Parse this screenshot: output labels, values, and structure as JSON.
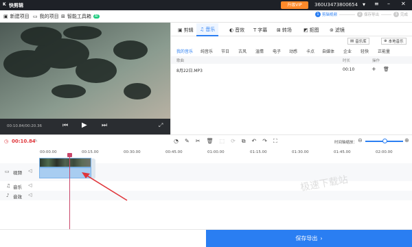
{
  "titlebar": {
    "app_name": "快剪辑",
    "vip_label": "升级VIP",
    "user_id": "360U3473800654",
    "steps": [
      {
        "num": "1",
        "label": "剪辑视频"
      },
      {
        "num": "2",
        "label": "保存导出"
      },
      {
        "num": "3",
        "label": "完成"
      }
    ]
  },
  "toolbar": {
    "items": [
      {
        "label": "新建项目",
        "icon": "new-project-icon"
      },
      {
        "label": "我的项目",
        "icon": "folder-icon"
      },
      {
        "label": "智能工具箱",
        "icon": "toolbox-icon"
      }
    ],
    "ai_badge": "AI"
  },
  "preview": {
    "timecode": "00:10.84/00:20.36"
  },
  "tabs": [
    {
      "label": "剪辑",
      "icon": "film-icon"
    },
    {
      "label": "音乐",
      "icon": "music-icon"
    },
    {
      "label": "音效",
      "icon": "speaker-icon"
    },
    {
      "label": "字幕",
      "icon": "text-icon"
    },
    {
      "label": "转场",
      "icon": "transition-icon"
    },
    {
      "label": "抠图",
      "icon": "cutout-icon"
    },
    {
      "label": "滤镜",
      "icon": "filter-icon"
    }
  ],
  "music_panel": {
    "library_btn": "音乐库",
    "local_btn": "本地音乐",
    "categories": [
      "我的音乐",
      "纯音乐",
      "节日",
      "古风",
      "温情",
      "电子",
      "动感",
      "卡点",
      "自媒体",
      "企业",
      "轻快",
      "正能量"
    ],
    "columns": {
      "name": "歌曲",
      "duration": "时长",
      "action": "操作"
    },
    "rows": [
      {
        "name": "8月22日.MP3",
        "duration": "00:10"
      }
    ]
  },
  "timeline": {
    "current_time": "00:10.84",
    "zoom_label": "时间轴缩放：",
    "ruler": [
      "00:00.00",
      "00:15.00",
      "00:30.00",
      "00:45.00",
      "01:00.00",
      "01:15.00",
      "01:30.00",
      "01:45.00",
      "02:00.00"
    ],
    "tracks": [
      {
        "label": "视频",
        "icon": "video-track-icon"
      },
      {
        "label": "音乐",
        "icon": "music-track-icon"
      },
      {
        "label": "音效",
        "icon": "sfx-track-icon"
      }
    ],
    "watermark": "极速下载站"
  },
  "bottom": {
    "export_label": "保存导出"
  }
}
